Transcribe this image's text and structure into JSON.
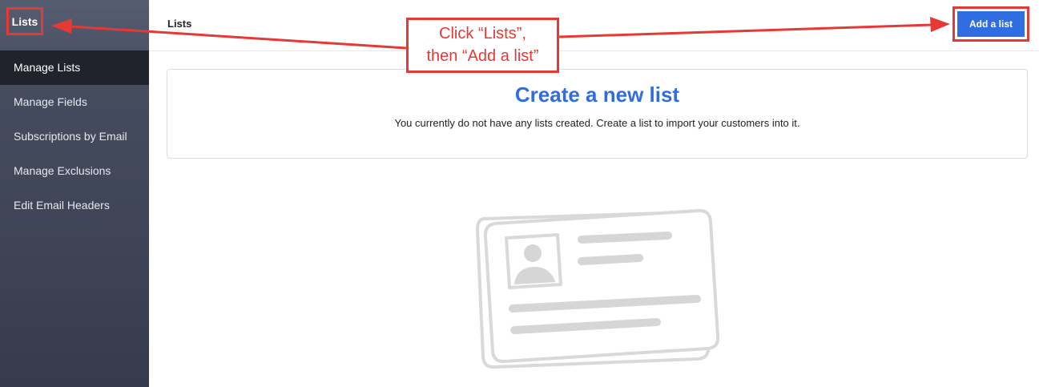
{
  "sidebar": {
    "title": "Lists",
    "items": [
      {
        "label": "Manage Lists",
        "active": true
      },
      {
        "label": "Manage Fields",
        "active": false
      },
      {
        "label": "Subscriptions by Email",
        "active": false
      },
      {
        "label": "Manage Exclusions",
        "active": false
      },
      {
        "label": "Edit Email Headers",
        "active": false
      }
    ]
  },
  "header": {
    "title": "Lists",
    "add_button_label": "Add a list"
  },
  "empty_state": {
    "title": "Create a new list",
    "message": "You currently do not have any lists created. Create a list to import your customers into it.",
    "illustration_icon": "contact-cards-icon"
  },
  "annotation": {
    "line1": "Click “Lists”,",
    "line2": "then “Add a list”"
  },
  "colors": {
    "accent": "#2f6de1",
    "annotation_red": "#e53935",
    "sidebar_bg": "#3f4557",
    "sidebar_active_bg": "#20232b"
  }
}
